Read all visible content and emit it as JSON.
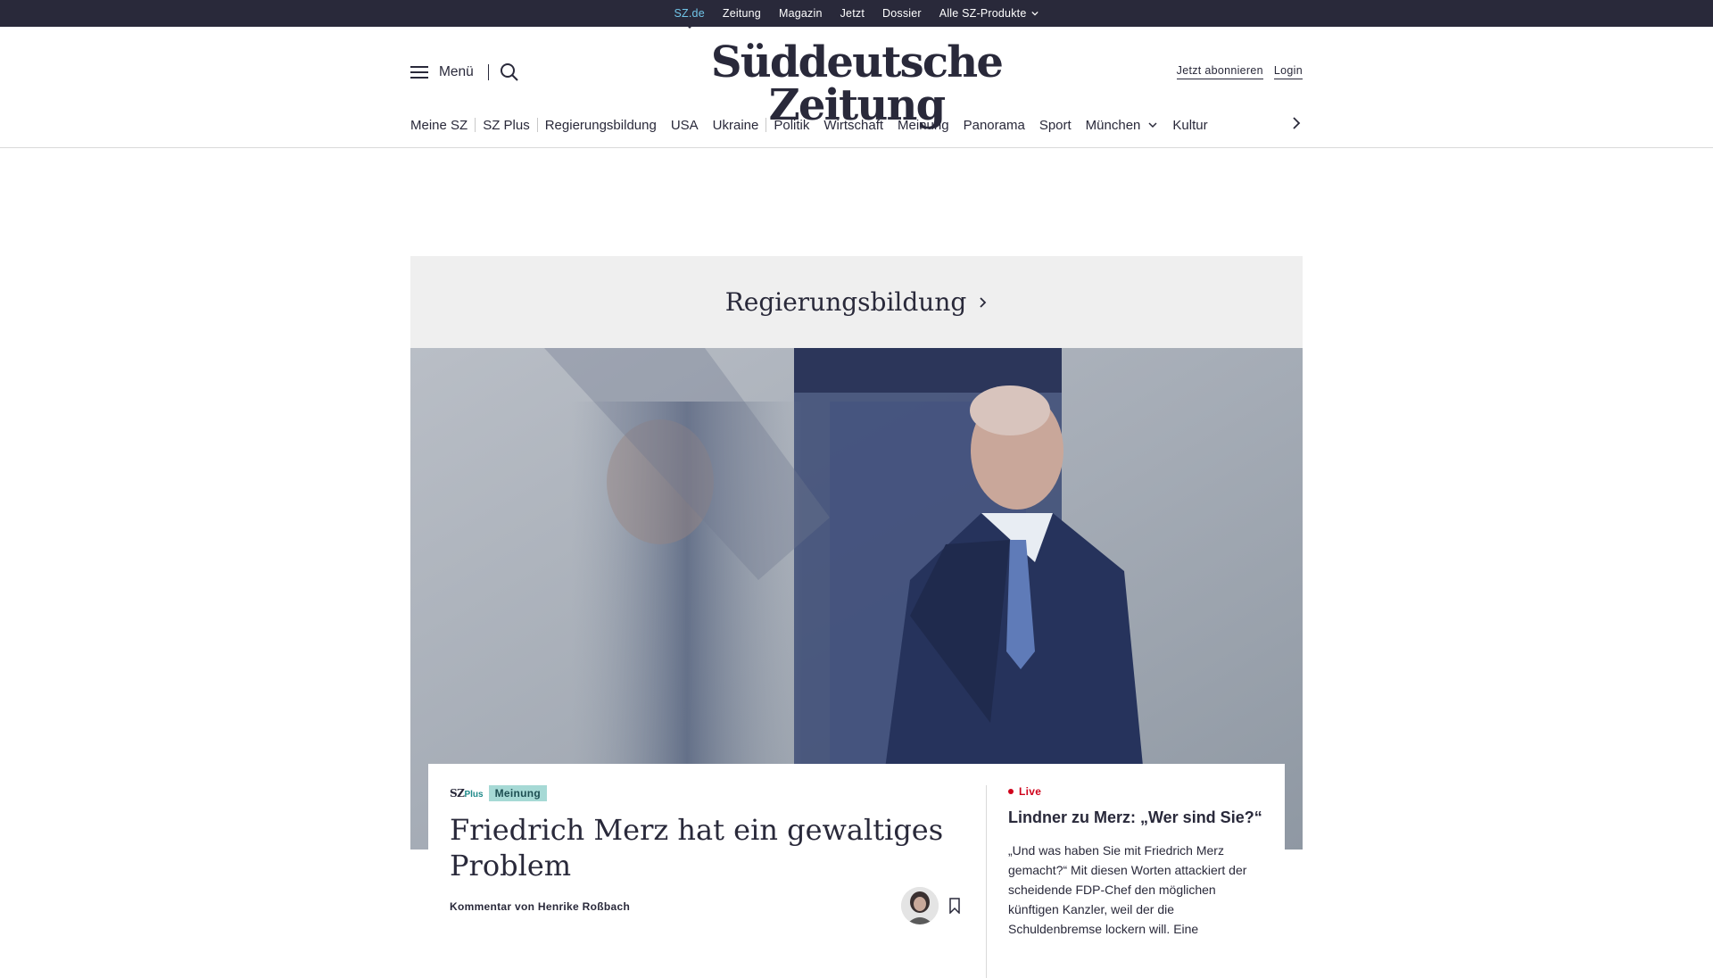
{
  "topbar": {
    "links": [
      "SZ.de",
      "Zeitung",
      "Magazin",
      "Jetzt",
      "Dossier",
      "Alle SZ-Produkte"
    ]
  },
  "header": {
    "menu_label": "Menü",
    "logo_text": "Süddeutsche Zeitung",
    "subscribe_label": "Jetzt abonnieren",
    "login_label": "Login"
  },
  "nav": {
    "items": [
      "Meine SZ",
      "SZ Plus",
      "Regierungsbildung",
      "USA",
      "Ukraine",
      "Politik",
      "Wirtschaft",
      "Meinung",
      "Panorama",
      "Sport",
      "München",
      "Kultur"
    ]
  },
  "section": {
    "title": "Regierungsbildung"
  },
  "teaser": {
    "brand_sz": "SZ",
    "brand_plus": "Plus",
    "tag": "Meinung",
    "headline": "Friedrich Merz hat ein gewaltiges Problem",
    "byline": "Kommentar von Henrike Roßbach"
  },
  "live_teaser": {
    "live_label": "Live",
    "title": "Lindner zu Merz: „Wer sind Sie?“",
    "text": "„Und was haben Sie mit Friedrich Merz gemacht?“ Mit diesen Worten attackiert der scheidende FDP-Chef den möglichen künftigen Kanzler, weil der die Schuldenbremse lockern will. Eine"
  },
  "colors": {
    "topbar_bg": "#29293a",
    "active_link": "#71c5e8",
    "tag_bg": "#a6d9d5",
    "live_red": "#d0021b",
    "section_bg": "#efefef"
  },
  "icons": [
    "hamburger-icon",
    "search-icon",
    "chevron-down-icon",
    "chevron-right-icon",
    "bookmark-icon"
  ]
}
